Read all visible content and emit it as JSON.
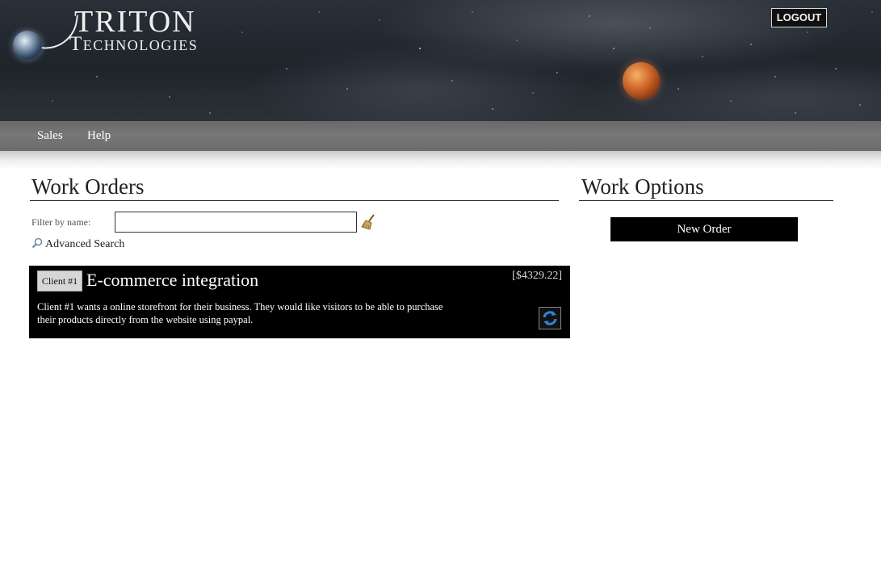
{
  "header": {
    "logo_line1": "TRITON",
    "logo_line2": "Technologies",
    "logout_label": "LOGOUT"
  },
  "nav": {
    "items": [
      {
        "label": "Sales"
      },
      {
        "label": "Help"
      }
    ]
  },
  "work_orders": {
    "title": "Work Orders",
    "filter_label": "Filter by name:",
    "filter_value": "",
    "advanced_search_label": "Advanced Search",
    "orders": [
      {
        "client": "Client #1",
        "title": "E-commerce integration",
        "price": "[$4329.22]",
        "description": "Client #1 wants a online storefront for their business. They would like visitors to be able to purchase their products directly from the website using paypal."
      }
    ]
  },
  "work_options": {
    "title": "Work Options",
    "new_order_label": "New Order"
  },
  "icons": {
    "broom": "broom-icon",
    "magnifier": "magnifier-icon",
    "refresh": "refresh-icon"
  },
  "colors": {
    "card_bg": "#000000",
    "accent_blue": "#2f86d8",
    "planet": "#cf6a2a"
  }
}
